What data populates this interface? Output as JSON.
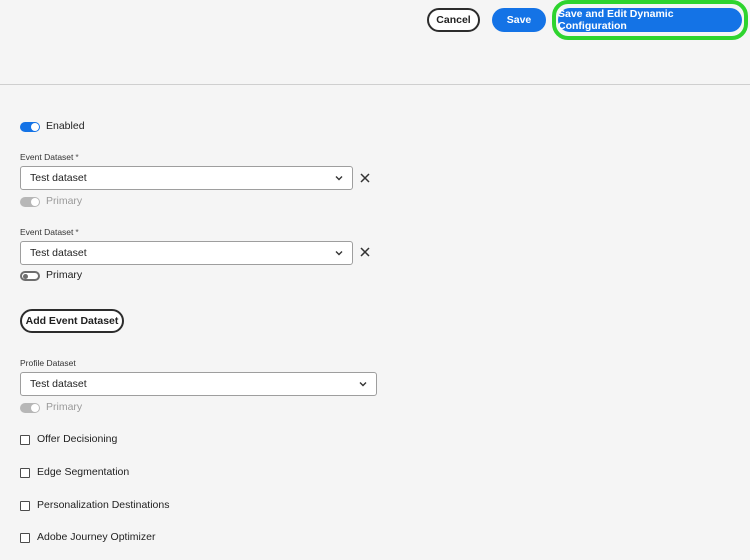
{
  "header": {
    "cancel_label": "Cancel",
    "save_label": "Save",
    "save_edit_label": "Save and Edit Dynamic Configuration"
  },
  "enabled_toggle": {
    "label": "Enabled",
    "on": true
  },
  "event_datasets": [
    {
      "label": "Event Dataset",
      "required_mark": "*",
      "value": "Test dataset",
      "primary_label": "Primary",
      "primary_on": true,
      "primary_disabled": true
    },
    {
      "label": "Event Dataset",
      "required_mark": "*",
      "value": "Test dataset",
      "primary_label": "Primary",
      "primary_on": false,
      "primary_disabled": false
    }
  ],
  "add_event_dataset_label": "Add Event Dataset",
  "profile_dataset": {
    "label": "Profile Dataset",
    "value": "Test dataset",
    "primary_label": "Primary",
    "primary_disabled": true
  },
  "checkboxes": [
    {
      "label": "Offer Decisioning",
      "checked": false
    },
    {
      "label": "Edge Segmentation",
      "checked": false
    },
    {
      "label": "Personalization Destinations",
      "checked": false
    },
    {
      "label": "Adobe Journey Optimizer",
      "checked": false
    }
  ],
  "colors": {
    "accent": "#1473e6",
    "highlight": "#2ed42e",
    "background": "#f5f5f5"
  },
  "icons": {
    "dropdown": "chevron-down-icon",
    "remove": "close-icon"
  }
}
